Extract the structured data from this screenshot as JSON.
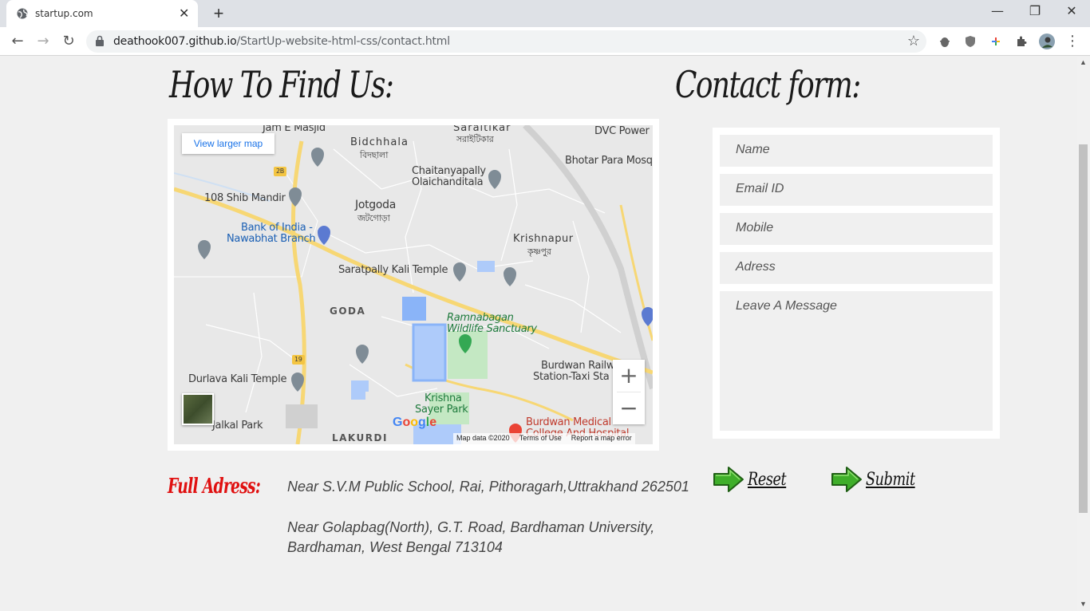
{
  "browser": {
    "tab_title": "startup.com",
    "new_tab": "+",
    "url_host": "deathook007.github.io",
    "url_path": "/StartUp-website-html-css/contact.html"
  },
  "page": {
    "find_heading": "How To Find Us:",
    "contact_heading": "Contact form:",
    "map": {
      "view_larger": "View larger map",
      "zoom_in": "+",
      "zoom_out": "−",
      "google": "Google",
      "map_data": "Map data ©2020",
      "terms": "Terms of Use",
      "report": "Report a map error",
      "labels": {
        "jam_masjid": "Jam E Masjid",
        "bidchhala": "Bidchhala",
        "bidchhala_bn": "বিদছালা",
        "saraitikar": "Saraitikar",
        "saraitikar_bn": "সরাইটিকার",
        "dvc_power": "DVC Power",
        "shib_mandir": "108 Shib Mandir",
        "chaitanyapally": "Chaitanyapally",
        "olaichanditala": "Olaichanditala",
        "bhotar_para": "Bhotar Para Mosq",
        "jotgoda": "Jotgoda",
        "jotgoda_bn": "জটগোড়া",
        "bank_india_1": "Bank of India -",
        "bank_india_2": "Nawabhat Branch",
        "krishnapur": "Krishnapur",
        "krishnapur_bn": "কৃষ্ণপুর",
        "saratpally": "Saratpally Kali Temple",
        "goda": "GODA",
        "ramnabagan_1": "Ramnabagan",
        "ramnabagan_2": "Wildlife Sanctuary",
        "burdwan_rail_1": "Burdwan Railw",
        "burdwan_rail_2": "Station-Taxi Sta",
        "durlava": "Durlava Kali Temple",
        "krishna_sayer_1": "Krishna",
        "krishna_sayer_2": "Sayer Park",
        "jalkal": "Jalkal Park",
        "lakurdi": "LAKURDI",
        "burdwan_medical_1": "Burdwan Medical",
        "burdwan_medical_2": "College And Hospital",
        "route_2b": "2B",
        "route_19": "19"
      }
    },
    "form": {
      "name_placeholder": "Name",
      "email_placeholder": "Email ID",
      "mobile_placeholder": "Mobile",
      "address_placeholder": "Adress",
      "message_placeholder": "Leave A Message",
      "reset_label": "Reset",
      "submit_label": "Submit"
    },
    "address": {
      "label": "Full Adress:",
      "line1": "Near S.V.M Public School, Rai, Pithoragarh,Uttrakhand 262501",
      "line2a": "Near Golapbag(North), G.T. Road, Bardhaman University,",
      "line2b": "Bardhaman, West Bengal 713104"
    }
  }
}
